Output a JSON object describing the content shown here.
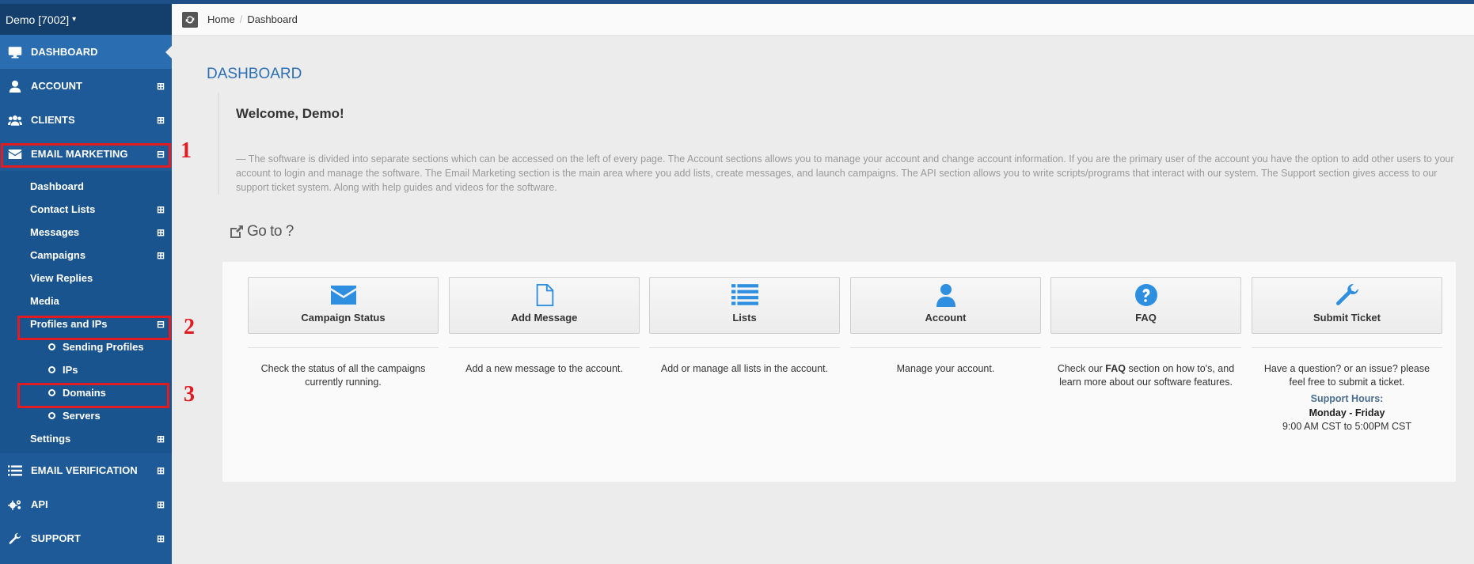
{
  "account_selector": "Demo [7002]",
  "nav": {
    "dashboard": "DASHBOARD",
    "account": "ACCOUNT",
    "clients": "CLIENTS",
    "email_marketing": "EMAIL MARKETING",
    "email_verification": "EMAIL VERIFICATION",
    "api": "API",
    "support": "SUPPORT"
  },
  "submenu": {
    "dashboard": "Dashboard",
    "contact_lists": "Contact Lists",
    "messages": "Messages",
    "campaigns": "Campaigns",
    "view_replies": "View Replies",
    "media": "Media",
    "profiles_ips": "Profiles and IPs",
    "sending_profiles": "Sending Profiles",
    "ips": "IPs",
    "domains": "Domains",
    "servers": "Servers",
    "settings": "Settings"
  },
  "expand_glyph": "⊞",
  "collapse_glyph": "⊟",
  "annotations": [
    "1",
    "2",
    "3"
  ],
  "breadcrumb": {
    "home": "Home",
    "sep": "/",
    "current": "Dashboard"
  },
  "page_title": "DASHBOARD",
  "welcome": {
    "heading": "Welcome, Demo!",
    "body": "— The software is divided into separate sections which can be accessed on the left of every page. The Account sections allows you to manage your account and change account information. If you are the primary user of the account you have the option to add other users to your account to login and manage the software. The Email Marketing section is the main area where you add lists, create messages, and launch campaigns. The API section allows you to write scripts/programs that interact with our system. The Support section gives access to our support ticket system. Along with help guides and videos for the software."
  },
  "goto_label": "Go to ?",
  "cards": [
    {
      "label": "Campaign Status",
      "icon": "envelope-icon",
      "desc": "Check the status of all the campaigns currently running."
    },
    {
      "label": "Add Message",
      "icon": "file-icon",
      "desc": "Add a new message to the account."
    },
    {
      "label": "Lists",
      "icon": "list-icon",
      "desc": "Add or manage all lists in the account."
    },
    {
      "label": "Account",
      "icon": "user-icon",
      "desc": "Manage your account."
    },
    {
      "label": "FAQ",
      "icon": "question-circle-icon",
      "desc_pre": "Check our ",
      "desc_bold": "FAQ",
      "desc_post": " section on how to's, and learn more about our software features."
    },
    {
      "label": "Submit Ticket",
      "icon": "wrench-icon",
      "desc": "Have a question? or an issue? please feel free to submit a ticket."
    }
  ],
  "support_hours": {
    "heading": "Support Hours:",
    "days": "Monday - Friday",
    "time": "9:00 AM CST to 5:00PM CST"
  },
  "colors": {
    "sidebar": "#1d5a97",
    "accent": "#2c6fb5",
    "icon_blue": "#2e8ee0",
    "annotation_red": "#e11b22"
  }
}
